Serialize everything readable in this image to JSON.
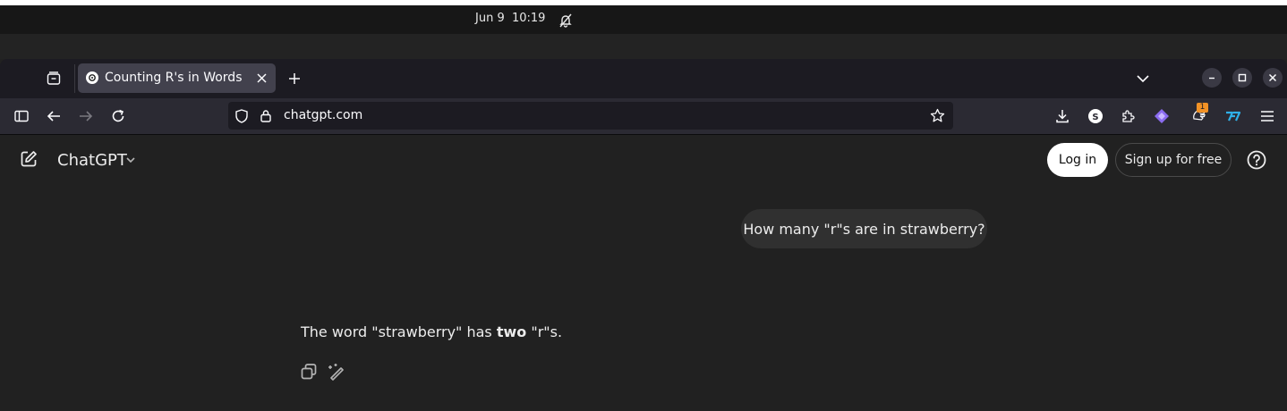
{
  "system": {
    "date": "Jun 9",
    "time": "10:19",
    "notification_icon": "bell-muted-icon"
  },
  "browser": {
    "tab": {
      "title": "Counting R's in Words",
      "favicon": "chatgpt-logo-icon"
    },
    "new_tab_icon": "plus-icon",
    "url": "chatgpt.com",
    "extensions_badge": "1"
  },
  "app": {
    "brand": "ChatGPT",
    "login_label": "Log in",
    "signup_label": "Sign up for free"
  },
  "conversation": {
    "user_message": "How many \"r\"s are in strawberry?",
    "assistant_prefix": "The word \"strawberry\" has ",
    "assistant_bold": "two",
    "assistant_suffix": " \"r\"s."
  },
  "colors": {
    "background": "#212121",
    "user_bubble": "#303030",
    "login_button": "#ffffff",
    "extension_purple": "#8b6cf0",
    "extension_blue": "#2fb0e8",
    "badge_orange": "#f29226"
  }
}
